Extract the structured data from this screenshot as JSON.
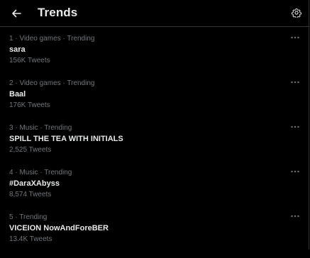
{
  "header": {
    "title": "Trends",
    "back_icon": "arrow-left-icon",
    "settings_icon": "gear-icon"
  },
  "trends": [
    {
      "meta": "1 · Video games · Trending",
      "name": "sara",
      "count": "156K Tweets"
    },
    {
      "meta": "2 · Video games · Trending",
      "name": "Baal",
      "count": "176K Tweets"
    },
    {
      "meta": "3 · Music · Trending",
      "name": "SPILL THE TEA WITH INITIALS",
      "count": "2,525 Tweets"
    },
    {
      "meta": "4 · Music · Trending",
      "name": "#DaraXAbyss",
      "count": "8,574 Tweets"
    },
    {
      "meta": "5 · Trending",
      "name": "VICEION NowAndForeBER",
      "count": "13.4K Tweets"
    }
  ],
  "colors": {
    "background": "#000000",
    "primary_text": "#e7e9ea",
    "secondary_text": "#71767b",
    "divider": "#2f3336"
  }
}
